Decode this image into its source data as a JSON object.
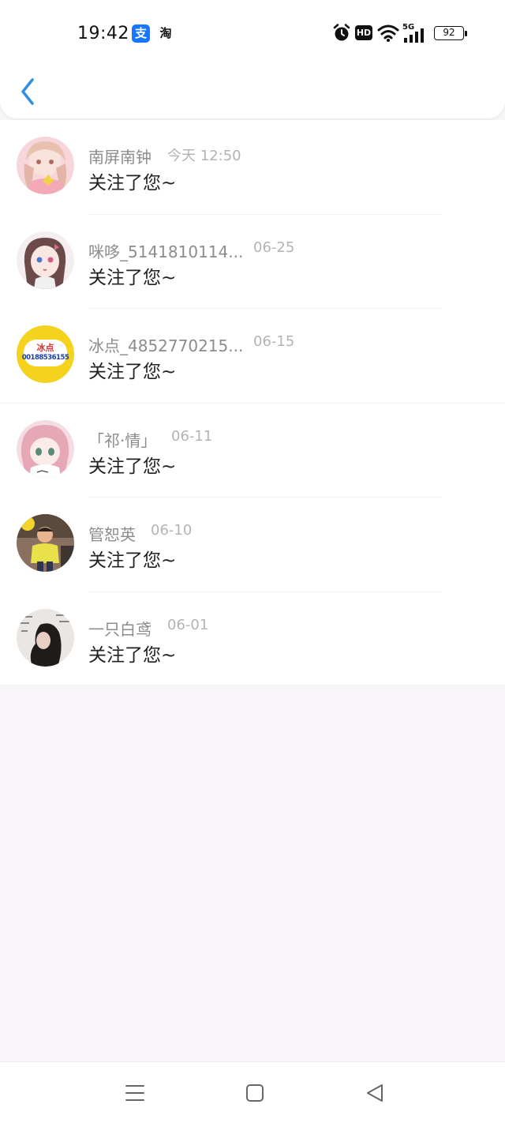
{
  "status_bar": {
    "time": "19:42",
    "alipay_glyph": "支",
    "taobao_glyph": "淘",
    "hd_label": "HD",
    "network_label": "5G",
    "battery": "92"
  },
  "nav": {
    "back_icon": "chevron-left-icon",
    "accent_color": "#2d8fe6"
  },
  "notifications": [
    {
      "name": "南屏南钟",
      "time": "今天 12:50",
      "message": "关注了您~"
    },
    {
      "name": "咪哆_5141810114...",
      "time": "06-25",
      "message": "关注了您~"
    },
    {
      "name": "冰点_4852770215...",
      "time": "06-15",
      "message": "关注了您~"
    },
    {
      "name": "「祁·情」",
      "time": "06-11",
      "message": "关注了您~"
    },
    {
      "name": "管恕英",
      "time": "06-10",
      "message": "关注了您~"
    },
    {
      "name": "一只白鸢",
      "time": "06-01",
      "message": "关注了您~"
    }
  ],
  "avatar_badge": {
    "text": "冰点",
    "number": "00188536155"
  },
  "system_nav": {
    "menu_icon": "menu-icon",
    "home_icon": "home-square-icon",
    "back_icon": "triangle-back-icon"
  }
}
